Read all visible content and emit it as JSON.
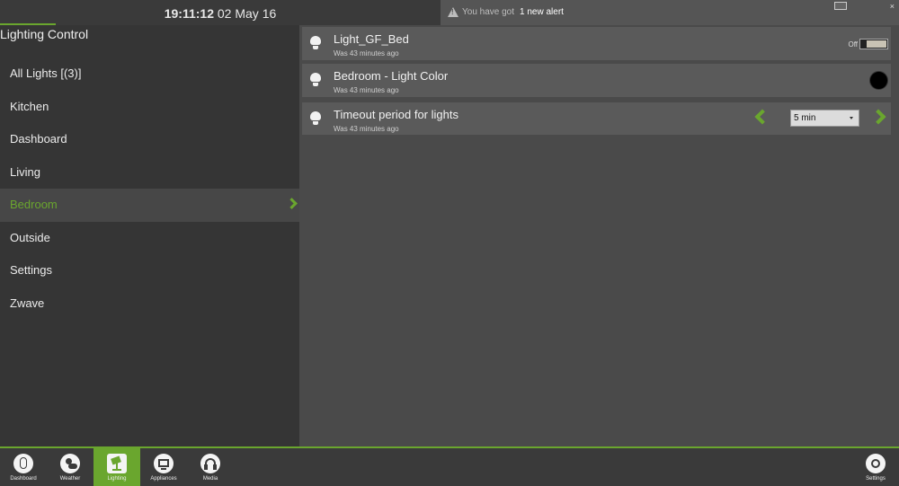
{
  "header": {
    "time": "19:11:12",
    "date": "02 May 16",
    "alert_prefix": "You have got",
    "alert_count": "1 new alert",
    "close_glyph": "×"
  },
  "sidebar": {
    "title": "Lighting Control",
    "items": [
      {
        "label": "All Lights [(3)]"
      },
      {
        "label": "Kitchen"
      },
      {
        "label": "Dashboard"
      },
      {
        "label": "Living"
      },
      {
        "label": "Bedroom",
        "active": true
      },
      {
        "label": "Outside"
      },
      {
        "label": "Settings"
      },
      {
        "label": "Zwave"
      }
    ]
  },
  "devices": [
    {
      "name": "Light_GF_Bed",
      "updated": "Was 43 minutes ago",
      "icon": "bulb-icon",
      "control": "toggle",
      "state": "Off"
    },
    {
      "name": "Bedroom - Light Color",
      "updated": "Was 43 minutes ago",
      "icon": "bulb-icon",
      "control": "color",
      "color": "#000000"
    },
    {
      "name": "Timeout period for lights",
      "updated": "Was 43 minutes ago",
      "icon": "bulb-icon",
      "control": "select",
      "value": "5 min"
    }
  ],
  "bottom_tabs": [
    {
      "label": "Dashboard",
      "icon": "mouse-icon"
    },
    {
      "label": "Weather",
      "icon": "sun-cloud-icon"
    },
    {
      "label": "Lighting",
      "icon": "lamp-icon",
      "active": true
    },
    {
      "label": "Appliances",
      "icon": "tv-icon"
    },
    {
      "label": "Media",
      "icon": "headphones-icon"
    },
    {
      "label": "Settings",
      "icon": "gear-icon"
    }
  ],
  "colors": {
    "accent": "#6aa62e",
    "sidebar_bg": "#353535",
    "main_bg": "#4a4a4a",
    "row_bg": "#5a5a5a"
  }
}
